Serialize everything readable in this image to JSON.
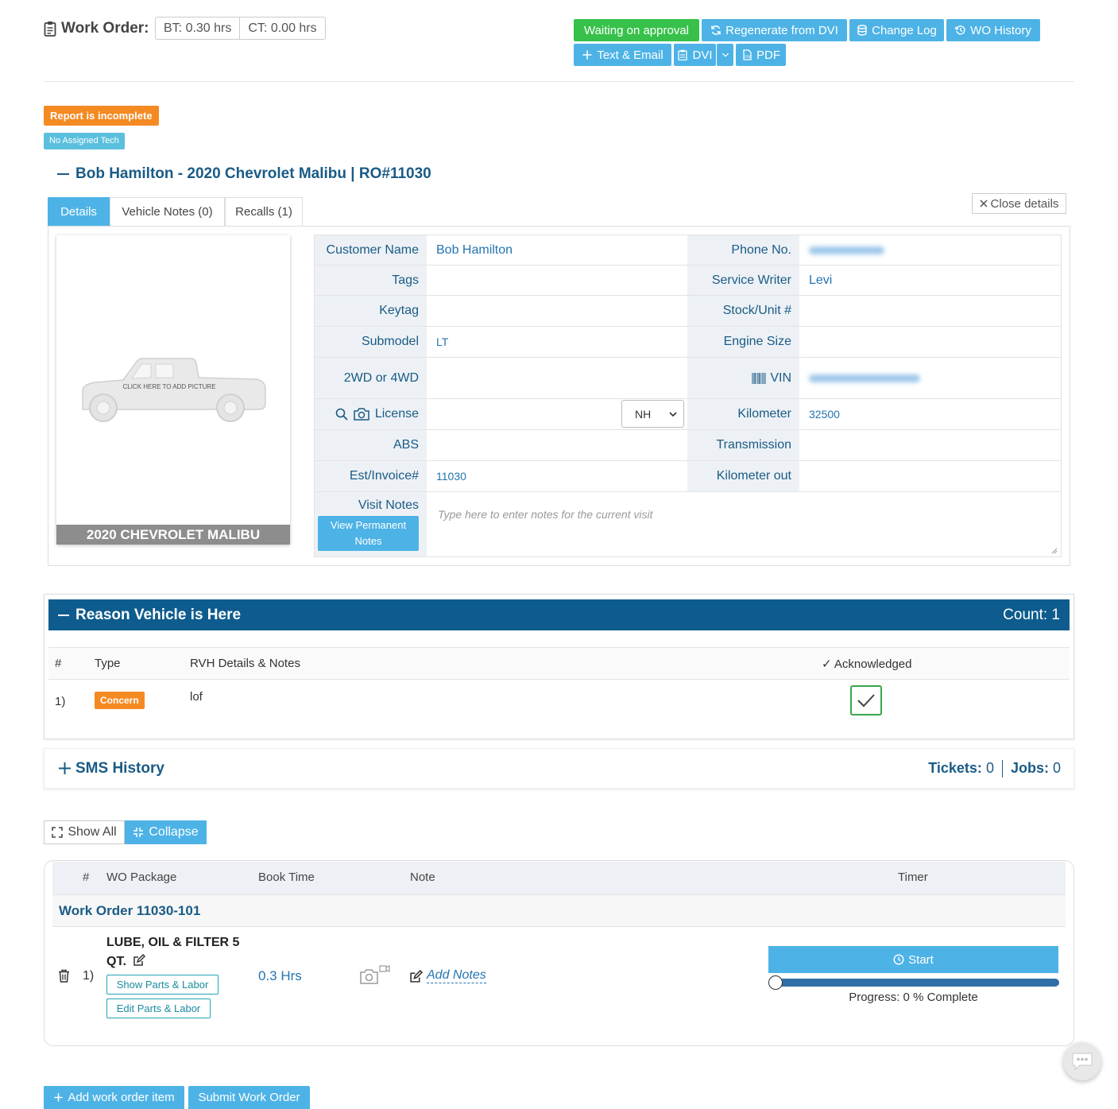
{
  "header": {
    "title": "Work Order:",
    "bt": "BT: 0.30 hrs",
    "ct": "CT: 0.00 hrs",
    "buttons": {
      "waiting": "Waiting on approval",
      "regenerate": "Regenerate from DVI",
      "change_log": "Change Log",
      "wo_history": "WO History",
      "text_email": "Text & Email",
      "dvi": "DVI",
      "pdf": "PDF"
    }
  },
  "status": {
    "report": "Report is incomplete",
    "tech": "No Assigned Tech"
  },
  "customer_header": "Bob Hamilton - 2020 Chevrolet Malibu | RO#11030",
  "tabs": [
    {
      "label": "Details",
      "active": true
    },
    {
      "label": "Vehicle Notes (0)",
      "active": false
    },
    {
      "label": "Recalls (1)",
      "active": false
    }
  ],
  "close_details": "Close details",
  "vehicle": {
    "photo_hint": "CLICK HERE TO ADD PICTURE",
    "caption": "2020 CHEVROLET MALIBU"
  },
  "details": {
    "customer_name_label": "Customer Name",
    "customer_name": "Bob Hamilton",
    "phone_label": "Phone No.",
    "tags_label": "Tags",
    "service_writer_label": "Service Writer",
    "service_writer": "Levi",
    "keytag_label": "Keytag",
    "stock_label": "Stock/Unit #",
    "submodel_label": "Submodel",
    "submodel": "LT",
    "engine_label": "Engine Size",
    "drive_label": "2WD or 4WD",
    "vin_label": "VIN",
    "license_label": "License",
    "license_state": "NH",
    "kilometer_label": "Kilometer",
    "kilometer": "32500",
    "abs_label": "ABS",
    "transmission_label": "Transmission",
    "est_label": "Est/Invoice#",
    "est": "11030",
    "km_out_label": "Kilometer out",
    "visit_notes_label": "Visit Notes",
    "perm_notes_btn": "View Permanent Notes",
    "visit_notes_placeholder": "Type here to enter notes for the current visit"
  },
  "rvh": {
    "title": "Reason Vehicle is Here",
    "count": "Count: 1",
    "columns": {
      "num": "#",
      "type": "Type",
      "details": "RVH Details & Notes",
      "ack": "✓ Acknowledged"
    },
    "rows": [
      {
        "num": "1)",
        "type": "Concern",
        "details": "lof",
        "acknowledged": true
      }
    ]
  },
  "sms": {
    "title": "SMS History",
    "tickets_label": "Tickets:",
    "tickets": "0",
    "jobs_label": "Jobs:",
    "jobs": "0"
  },
  "view_controls": {
    "show_all": "Show All",
    "collapse": "Collapse"
  },
  "wo_table": {
    "columns": {
      "num": "#",
      "package": "WO Package",
      "book_time": "Book Time",
      "note": "Note",
      "timer": "Timer"
    },
    "work_order": "Work Order 11030-101",
    "items": [
      {
        "num": "1)",
        "name": "LUBE, OIL & FILTER 5 QT.",
        "show_parts": "Show Parts & Labor",
        "edit_parts": "Edit Parts & Labor",
        "book_time": "0.3 Hrs",
        "add_notes": "Add Notes",
        "start": "Start",
        "progress_pct": 0,
        "progress_text": "Progress: 0 % Complete"
      }
    ]
  },
  "footer": {
    "add_item": "Add work order item",
    "submit": "Submit Work Order"
  },
  "colors": {
    "primary": "#4db3e6",
    "navy": "#0e5c8e",
    "text_blue": "#1a5b86",
    "green": "#37c14a",
    "orange": "#f58a23"
  }
}
